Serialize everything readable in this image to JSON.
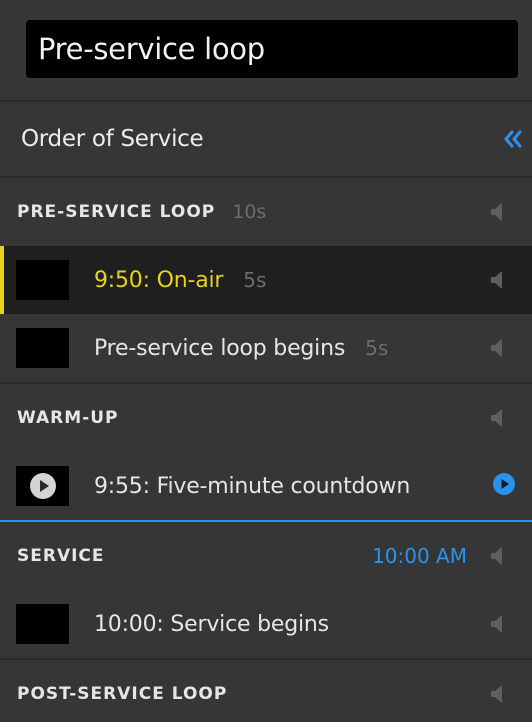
{
  "title": "Pre-service loop",
  "header": {
    "label": "Order of Service",
    "collapse_icon": "double-chevron-left-icon"
  },
  "colors": {
    "accent_blue": "#2a93f0",
    "active_yellow": "#e7d21a",
    "muted": "#6c6c6c"
  },
  "sections": [
    {
      "name": "PRE-SERVICE LOOP",
      "duration": "10s",
      "time": "",
      "cues": [
        {
          "name": "9:50: On-air",
          "duration": "5s",
          "active": true
        },
        {
          "name": "Pre-service loop begins",
          "duration": "5s",
          "active": false
        }
      ]
    },
    {
      "name": "WARM-UP",
      "duration": "",
      "time": "",
      "cues": [
        {
          "name": "9:55: Five-minute countdown",
          "duration": "",
          "playing_icon": "play-icon",
          "status_icon": "play-circle-icon"
        }
      ]
    },
    {
      "name": "SERVICE",
      "duration": "",
      "time": "10:00 AM",
      "cues": [
        {
          "name": "10:00: Service begins",
          "duration": ""
        }
      ]
    },
    {
      "name": "POST-SERVICE LOOP",
      "duration": "",
      "time": "",
      "cues": []
    }
  ]
}
